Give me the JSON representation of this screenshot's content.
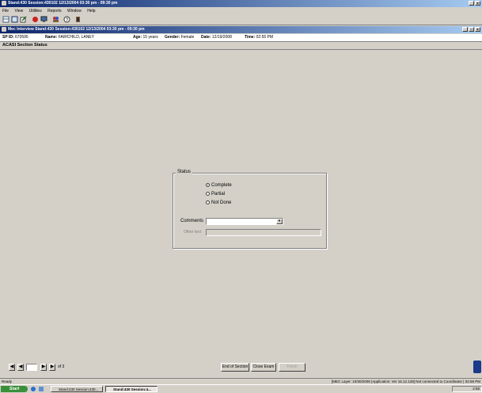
{
  "app": {
    "title": "Stand:430 Session:430102 12/13/2004 03:30 pm - 09:30 pm",
    "window_buttons": [
      "_",
      "×"
    ]
  },
  "menu": [
    "File",
    "View",
    "Utilities",
    "Reports",
    "Window",
    "Help"
  ],
  "inner_window": {
    "title": "Mec Interview Stand:430 Session:430102 12/13/2004 03:30 pm - 09:30 pm",
    "window_buttons": [
      "_",
      "□",
      "×"
    ]
  },
  "participant": {
    "sp_id_label": "SP ID:",
    "sp_id": "670595",
    "name_label": "Name:",
    "name": "FAIRCHILD, LANEY",
    "age_label": "Age:",
    "age": "15 years",
    "gender_label": "Gender:",
    "gender": "Female",
    "date_label": "Date:",
    "date": "12/19/2008",
    "time_label": "Time:",
    "time": "02:55 PM"
  },
  "section_title": "ACASI Section Status",
  "status_group": {
    "label": "Status",
    "options": [
      {
        "label": "Complete",
        "checked": true
      },
      {
        "label": "Partial",
        "checked": false
      },
      {
        "label": "Not Done",
        "checked": false
      }
    ],
    "comments_label": "Comments",
    "comments_value": "",
    "other_text_label": "Other text",
    "other_text_value": ""
  },
  "pager": {
    "current_page": "",
    "of_text": "of 3"
  },
  "buttons": {
    "end_of_section": "End of Section",
    "close_exam": "Close Exam",
    "finish": "Finish"
  },
  "statusbar": {
    "left": "Ready",
    "right": "[MEC Layer: 10/30/2008 |Application: Ver 16.12.128]  Not connected to Coordinator  | 02:58 PM"
  },
  "taskbar": {
    "start": "Start",
    "tasks": [
      "Stand:430 Session:430...",
      "Stand:430 Session:4..."
    ],
    "clock": "2:58"
  },
  "colors": {
    "title_start": "#0a246a",
    "title_end": "#a6caf0",
    "face": "#d4d0c8"
  }
}
